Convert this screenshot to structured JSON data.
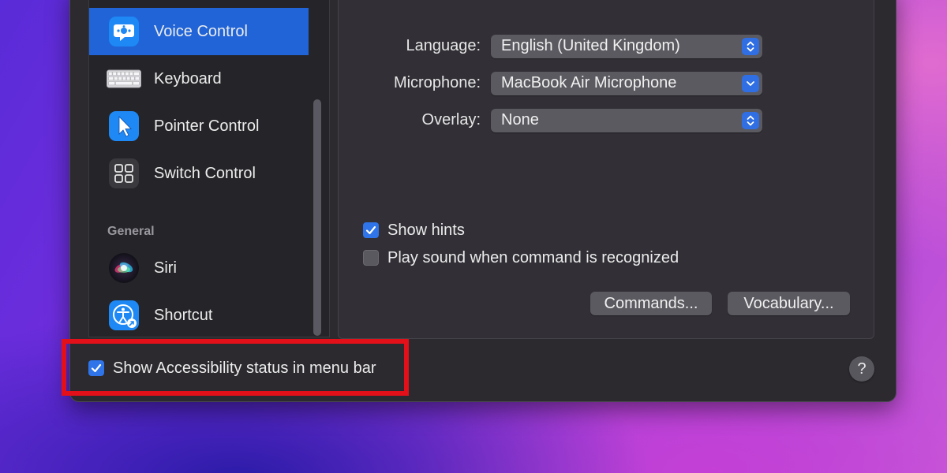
{
  "sidebar": {
    "items": [
      {
        "label": "Voice Control",
        "icon": "voice-control-icon",
        "selected": true
      },
      {
        "label": "Keyboard",
        "icon": "keyboard-icon"
      },
      {
        "label": "Pointer Control",
        "icon": "pointer-control-icon"
      },
      {
        "label": "Switch Control",
        "icon": "switch-control-icon"
      },
      {
        "label": "Siri",
        "icon": "siri-icon"
      },
      {
        "label": "Shortcut",
        "icon": "accessibility-shortcut-icon"
      }
    ],
    "section_general": "General"
  },
  "form": {
    "language_label": "Language:",
    "language_value": "English (United Kingdom)",
    "microphone_label": "Microphone:",
    "microphone_value": "MacBook Air Microphone",
    "overlay_label": "Overlay:",
    "overlay_value": "None"
  },
  "options": {
    "show_hints_label": "Show hints",
    "show_hints_checked": true,
    "play_sound_label": "Play sound when command is recognized",
    "play_sound_checked": false
  },
  "buttons": {
    "commands": "Commands...",
    "vocabulary": "Vocabulary..."
  },
  "footer": {
    "status_label": "Show Accessibility status in menu bar",
    "status_checked": true,
    "help": "?"
  },
  "colors": {
    "selection": "#2064d8",
    "accent": "#2f74e8",
    "highlight_border": "#e3101a"
  }
}
